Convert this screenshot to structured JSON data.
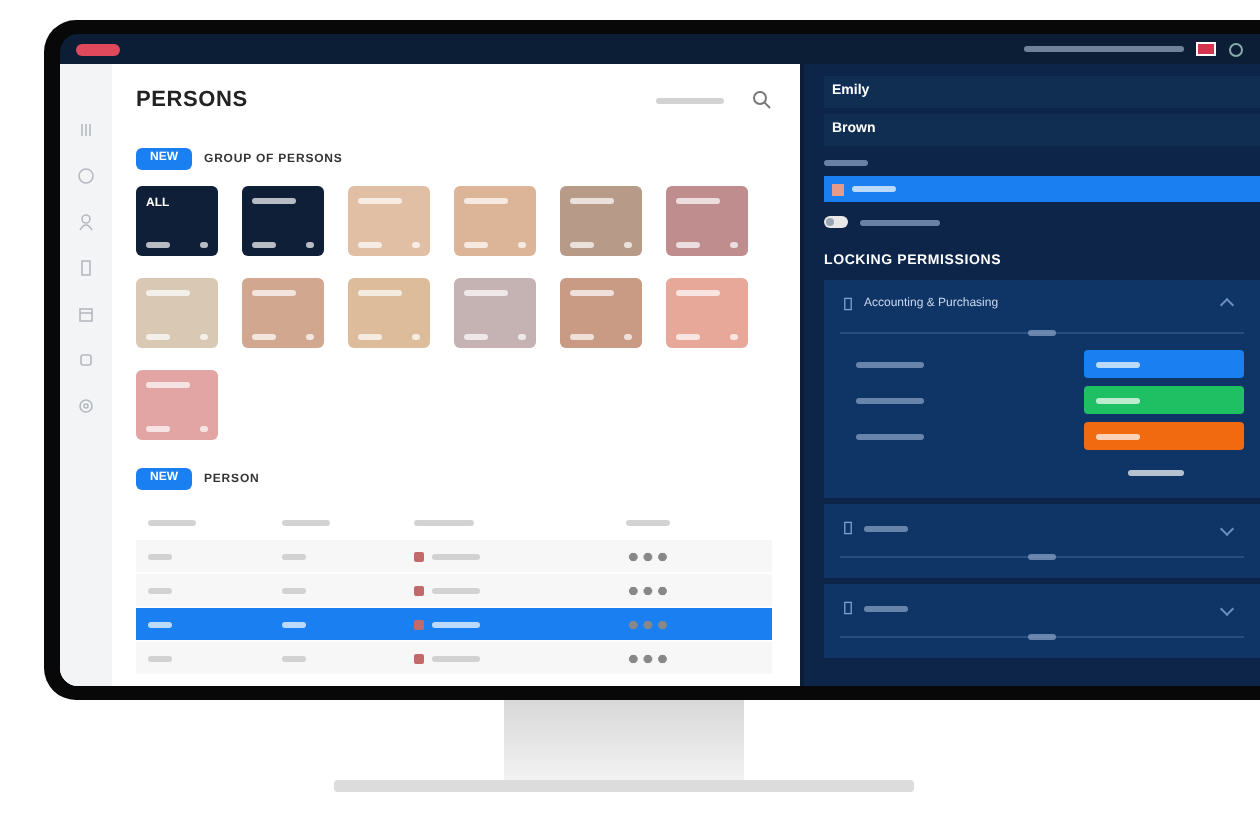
{
  "persons_page": {
    "title": "PERSONS",
    "groups": {
      "new_button": "NEW",
      "heading": "GROUP OF PERSONS",
      "tiles": [
        {
          "label": "ALL",
          "color": "#0f1f38"
        },
        {
          "color": "#0f1f38"
        },
        {
          "color": "#e0bfa5"
        },
        {
          "color": "#dcb497"
        },
        {
          "color": "#b89a88"
        },
        {
          "color": "#c08d8f"
        },
        {
          "color": "#d8c8b4"
        },
        {
          "color": "#d1a78f"
        },
        {
          "color": "#ddbc9c"
        },
        {
          "color": "#c5b3b3"
        },
        {
          "color": "#c99a84"
        },
        {
          "color": "#e7a89a"
        },
        {
          "color": "#e2a5a3"
        }
      ]
    },
    "persons": {
      "new_button": "NEW",
      "heading": "PERSON",
      "rows": [
        {
          "selected": false
        },
        {
          "selected": false
        },
        {
          "selected": true
        },
        {
          "selected": false
        }
      ]
    }
  },
  "detail_panel": {
    "first_name": "Emily",
    "last_name": "Brown",
    "blocking_toggle": {
      "on": false
    },
    "heading": "LOCKING PERMISSIONS",
    "sections": [
      {
        "title": "Accounting & Purchasing",
        "expanded": true,
        "permissions": [
          {
            "color": "#1a7ff0"
          },
          {
            "color": "#1fbf63"
          },
          {
            "color": "#f26a10"
          }
        ]
      },
      {
        "expanded": false
      },
      {
        "expanded": false
      }
    ]
  }
}
